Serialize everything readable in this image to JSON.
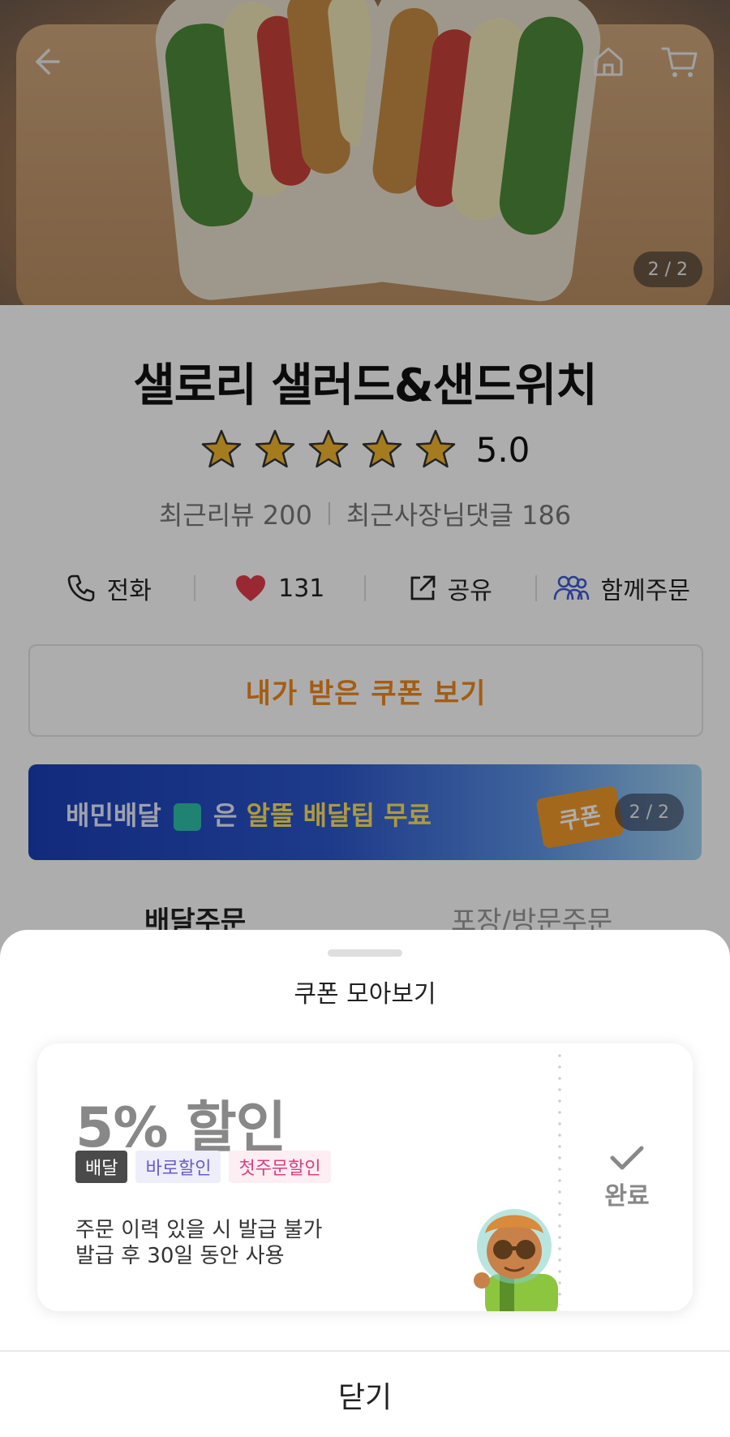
{
  "hero": {
    "image_counter": "2 / 2"
  },
  "store": {
    "name": "샐로리 샐러드&샌드위치",
    "rating_score": "5.0",
    "star_count": 5,
    "recent_reviews": "최근리뷰 200",
    "owner_replies": "최근사장님댓글 186"
  },
  "actions": {
    "call_label": "전화",
    "like_count": "131",
    "share_label": "공유",
    "group_order_label": "함께주문"
  },
  "coupon_button_label": "내가 받은 쿠폰 보기",
  "banner": {
    "text_part1": "배민배달",
    "text_part2": "은",
    "text_highlight": "알뜰 배달팁 무료",
    "coupon_badge": "쿠폰",
    "counter": "2 / 2"
  },
  "tabs": {
    "delivery": "배달주문",
    "pickup": "포장/방문주문"
  },
  "sheet": {
    "title": "쿠폰 모아보기",
    "coupon": {
      "title": "5% 할인",
      "tags": [
        "배달",
        "바로할인",
        "첫주문할인"
      ],
      "desc_line1": "주문 이력 있을 시 발급 불가",
      "desc_line2": "발급 후 30일 동안 사용",
      "status": "완료"
    },
    "close_label": "닫기"
  },
  "colors": {
    "accent_orange": "#f08a1c",
    "heart_red": "#e23c4c",
    "group_blue": "#3f5bd9"
  }
}
